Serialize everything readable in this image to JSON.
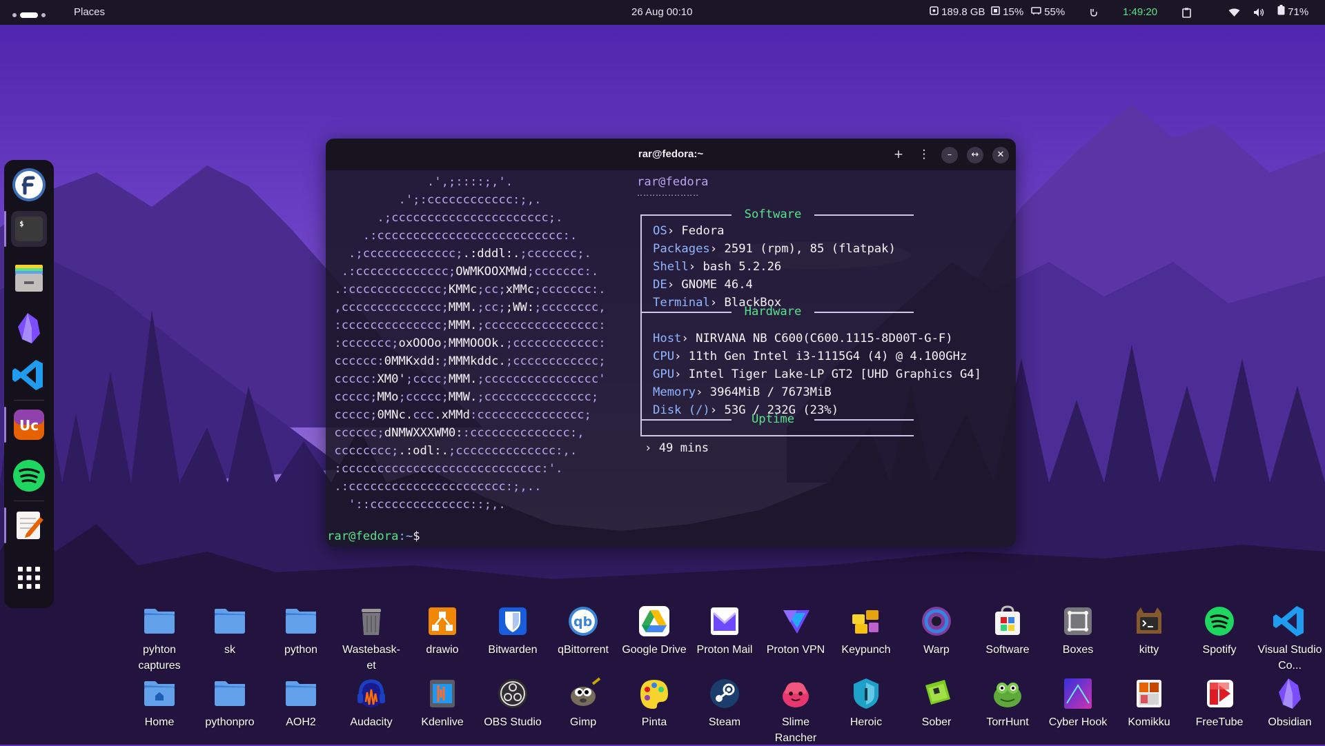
{
  "topbar": {
    "activities": "Places",
    "datetime": "26 Aug  00:10",
    "disk": "189.8 GB",
    "cpu": "15%",
    "ram": "55%",
    "timer": "1:49:20",
    "battery": "71%",
    "icons": [
      "workspace-indicator",
      "disk-icon",
      "cpu-icon",
      "memory-icon",
      "caffeine-icon",
      "clipboard-icon",
      "wifi-icon",
      "volume-icon",
      "battery-icon"
    ]
  },
  "dock": {
    "items": [
      "fedora",
      "terminal",
      "files",
      "obsidian",
      "vscode",
      "unicode-app",
      "spotify",
      "text-editor",
      "app-grid"
    ]
  },
  "terminal": {
    "title": "rar@fedora:~",
    "userhost": "rar@fedora",
    "userhost_underline": "‥‥‥‥‥‥‥‥‥‥",
    "sections": {
      "software": "Software",
      "hardware": "Hardware",
      "uptime": "Uptime"
    },
    "info": [
      {
        "key": "OS",
        "value": "Fedora"
      },
      {
        "key": "Packages",
        "value": "2591 (rpm), 85 (flatpak)"
      },
      {
        "key": "Shell",
        "value": "bash 5.2.26"
      },
      {
        "key": "DE",
        "value": "GNOME 46.4"
      },
      {
        "key": "Terminal",
        "value": "BlackBox"
      },
      {
        "key": "Host",
        "value": "NIRVANA NB C600(C600.1115-8D00T-G-F)"
      },
      {
        "key": "CPU",
        "value": "11th Gen Intel i3-1115G4 (4) @ 4.100GHz"
      },
      {
        "key": "GPU",
        "value": "Intel Tiger Lake-LP GT2 [UHD Graphics G4]"
      },
      {
        "key": "Memory",
        "value": "3964MiB / 7673MiB"
      },
      {
        "key": "Disk (/)",
        "value": "53G / 232G (23%)"
      }
    ],
    "uptime_value": "49 mins",
    "prompt_user": "rar@fedora",
    "prompt_path": ":~",
    "prompt_symbol": "$"
  },
  "desktop_icons": {
    "row1": [
      {
        "label": "pyhton captures",
        "icon": "folder"
      },
      {
        "label": "sk",
        "icon": "folder"
      },
      {
        "label": "python",
        "icon": "folder"
      },
      {
        "label": "Wastebask-et",
        "icon": "trash"
      },
      {
        "label": "drawio",
        "icon": "drawio"
      },
      {
        "label": "Bitwarden",
        "icon": "bitwarden"
      },
      {
        "label": "qBittorrent",
        "icon": "qbittorrent"
      },
      {
        "label": "Google Drive",
        "icon": "google-drive"
      },
      {
        "label": "Proton Mail",
        "icon": "proton-mail"
      },
      {
        "label": "Proton VPN",
        "icon": "proton-vpn"
      },
      {
        "label": "Keypunch",
        "icon": "keypunch"
      },
      {
        "label": "Warp",
        "icon": "warp"
      },
      {
        "label": "Software",
        "icon": "software"
      },
      {
        "label": "Boxes",
        "icon": "boxes"
      },
      {
        "label": "kitty",
        "icon": "kitty"
      },
      {
        "label": "Spotify",
        "icon": "spotify"
      },
      {
        "label": "Visual Studio Co...",
        "icon": "vscode"
      }
    ],
    "row2": [
      {
        "label": "Home",
        "icon": "home-folder"
      },
      {
        "label": "pythonpro",
        "icon": "folder"
      },
      {
        "label": "AOH2",
        "icon": "folder"
      },
      {
        "label": "Audacity",
        "icon": "audacity"
      },
      {
        "label": "Kdenlive",
        "icon": "kdenlive"
      },
      {
        "label": "OBS Studio",
        "icon": "obs"
      },
      {
        "label": "Gimp",
        "icon": "gimp"
      },
      {
        "label": "Pinta",
        "icon": "pinta"
      },
      {
        "label": "Steam",
        "icon": "steam"
      },
      {
        "label": "Slime Rancher",
        "icon": "slime-rancher"
      },
      {
        "label": "Heroic",
        "icon": "heroic"
      },
      {
        "label": "Sober",
        "icon": "sober"
      },
      {
        "label": "TorrHunt",
        "icon": "torrhunt"
      },
      {
        "label": "Cyber Hook",
        "icon": "cyber-hook"
      },
      {
        "label": "Komikku",
        "icon": "komikku"
      },
      {
        "label": "FreeTube",
        "icon": "freetube"
      },
      {
        "label": "Obsidian",
        "icon": "obsidian"
      }
    ]
  },
  "colors": {
    "accent_green": "#57e389",
    "key_blue": "#8fb6ff",
    "ascii_purple": "#b9a5ec",
    "sky_top": "#4a22a8",
    "folder_blue": "#4a90e2"
  }
}
